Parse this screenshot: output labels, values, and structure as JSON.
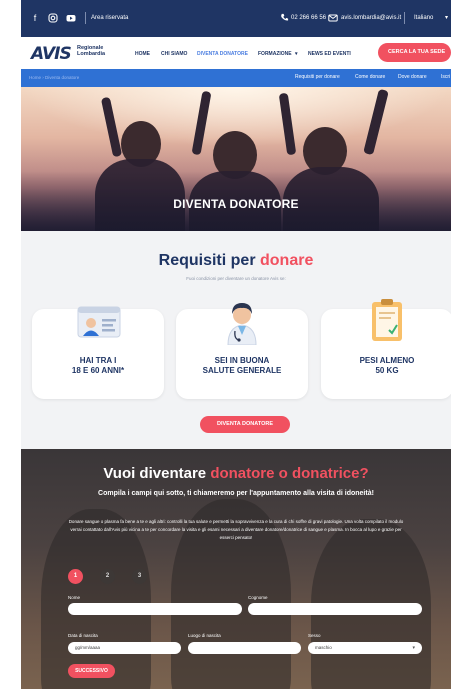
{
  "topbar": {
    "reserved_area": "Area riservata",
    "phone": "02 266 66 56",
    "email": "avis.lombardia@avis.it",
    "language": "Italiano"
  },
  "header": {
    "logo_mark": "AVIS",
    "logo_region_line1": "Regionale",
    "logo_region_line2": "Lombardia",
    "nav": [
      "HOME",
      "CHI SIAMO",
      "DIVENTA DONATORE",
      "FORMAZIONE",
      "NEWS ED EVENTI"
    ],
    "cta": "CERCA LA TUA SEDE"
  },
  "subbar": {
    "breadcrumb": "Home  ›  Diventa donatore",
    "links": [
      "Requisiti per donare",
      "Come donare",
      "Dove donare",
      "Iscri"
    ]
  },
  "hero": {
    "title": "DIVENTA DONATORE"
  },
  "requirements": {
    "title_main": "Requisiti per ",
    "title_accent": "donare",
    "subtitle": "Fuoi condizioni per diventare un donatore Avis se:",
    "cards": [
      {
        "line1": "HAI TRA I",
        "line2": "18 E 60 ANNI*"
      },
      {
        "line1": "SEI IN BUONA",
        "line2": "SALUTE GENERALE"
      },
      {
        "line1": "PESI ALMENO",
        "line2": "50 KG"
      }
    ],
    "cta": "DIVENTA DONATORE",
    "weight_tag": "50 kg"
  },
  "form": {
    "title_main": "Vuoi diventare ",
    "title_accent": "donatore o donatrice?",
    "subtitle": "Compila i campi qui sotto, ti chiameremo per l'appuntamento alla visita di idoneità!",
    "paragraph": "Donare sangue o plasma fa bene a te e agli altri: controlli la tua salute e permetti la sopravvivenza e la cura di chi soffre di gravi patologie. Una volta compilato il modulo verrai contattato dall'Avis più vicina a te per concordare la visita e gli esami necessari a diventare donatore/donatrice di sangue e plasma. In bocca al lupo e grazie per esserci pensato!",
    "steps": [
      "1",
      "2",
      "3"
    ],
    "fields": {
      "nome_label": "Nome",
      "cognome_label": "Cognome",
      "data_label": "Data di nascita",
      "data_placeholder": "gg/mm/aaaa",
      "luogo_label": "Luogo di nascita",
      "sesso_label": "Sesso",
      "sesso_value": "maschio"
    },
    "next": "SUCCESSIVO"
  }
}
